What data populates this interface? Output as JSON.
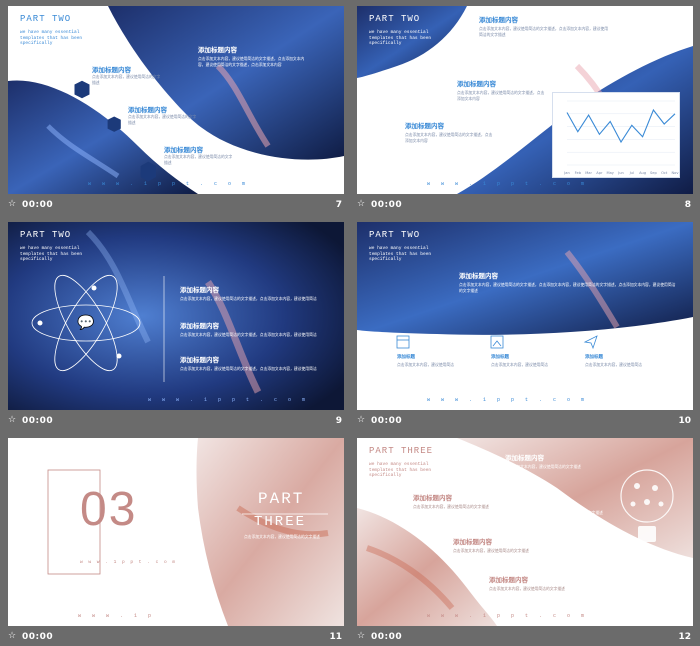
{
  "slides": {
    "s7": {
      "number": "7",
      "time": "00:00",
      "part": "PART TWO",
      "tagline": "we have many essential templates that has been specifically",
      "url": "w w w . 1 p p t . c o m",
      "heading_main": "添加标题内容",
      "heading_a": "添加标题内容",
      "heading_b": "添加标题内容",
      "heading_c": "添加标题内容",
      "body_main": "点击添加文本内容，建议使用简洁的文字描述，点击添加文本内容，建议使用简洁的文字描述，点击添加文本内容",
      "body_a": "点击添加文本内容，建议使用简洁的文字描述",
      "body_b": "点击添加文本内容，建议使用简洁的文字描述",
      "body_c": "点击添加文本内容，建议使用简洁的文字描述"
    },
    "s8": {
      "number": "8",
      "time": "00:00",
      "part": "PART TWO",
      "tagline": "we have many essential templates that has been specifically",
      "url": "w w w . 1 p p t . c o m",
      "heading_1": "添加标题内容",
      "heading_2": "添加标题内容",
      "heading_3": "添加标题内容",
      "body_1": "点击添加文本内容，建议使用简洁的文字描述，点击添加文本内容，建议使用简洁的文字描述",
      "body_2": "点击添加文本内容，建议使用简洁的文字描述，点击添加文本内容",
      "body_3": "点击添加文本内容，建议使用简洁的文字描述，点击添加文本内容"
    },
    "s9": {
      "number": "9",
      "time": "00:00",
      "part": "PART TWO",
      "tagline": "we have many essential templates that has been specifically",
      "url": "w w w . 1 p p t . c o m",
      "heading_1": "添加标题内容",
      "heading_2": "添加标题内容",
      "heading_3": "添加标题内容",
      "body_1": "点击添加文本内容，建议使用简洁的文字描述，点击添加文本内容，建议使用简洁",
      "body_2": "点击添加文本内容，建议使用简洁的文字描述，点击添加文本内容，建议使用简洁",
      "body_3": "点击添加文本内容，建议使用简洁的文字描述，点击添加文本内容，建议使用简洁"
    },
    "s10": {
      "number": "10",
      "time": "00:00",
      "part": "PART TWO",
      "tagline": "we have many essential templates that has been specifically",
      "url": "w w w . 1 p p t . c o m",
      "heading": "添加标题内容",
      "body": "点击添加文本内容，建议使用简洁的文字描述，点击添加文本内容，建议使用简洁的文字描述，点击添加文本内容，建议使用简洁的文字描述",
      "feat_1_title": "添加标题",
      "feat_2_title": "添加标题",
      "feat_3_title": "添加标题",
      "feat_1_body": "点击添加文本内容，建议使用简洁",
      "feat_2_body": "点击添加文本内容，建议使用简洁",
      "feat_3_body": "点击添加文本内容，建议使用简洁"
    },
    "s11": {
      "number": "11",
      "time": "00:00",
      "big_number": "03",
      "part_line1": "PART",
      "part_line2": "THREE",
      "url_small": "w w w . 1 p p t . c o m",
      "url": "w w w . 1 p",
      "body": "点击添加文本内容，建议使用简洁的文字描述"
    },
    "s12": {
      "number": "12",
      "time": "00:00",
      "part": "PART THREE",
      "tagline": "we have many essential templates that has been specifically",
      "url": "w w w . 1 p p t . c o m",
      "heading_1": "添加标题内容",
      "heading_2": "添加标题内容",
      "heading_3": "添加标题内容",
      "heading_4": "添加标题内容",
      "heading_5": "添加标题内容",
      "body_1": "点击添加文本内容，建议使用简洁的文字描述",
      "body_2": "点击添加文本内容，建议使用简洁的文字描述",
      "body_3": "点击添加文本内容，建议使用简洁的文字描述",
      "body_4": "点击添加文本内容，建议使用简洁的文字描述",
      "body_5": "点击添加文本内容，建议使用简洁的文字描述"
    }
  },
  "chart_data": {
    "type": "line",
    "categories": [
      "Jan",
      "Feb",
      "Mar",
      "Apr",
      "May",
      "Jun",
      "Jul",
      "Aug",
      "Sep",
      "Oct",
      "Nov"
    ],
    "values": [
      4.1,
      2.6,
      3.9,
      2.4,
      3.4,
      1.8,
      3.1,
      2.2,
      4.3,
      3.2,
      4.0
    ],
    "ylim": [
      0,
      5
    ]
  },
  "colors": {
    "accent_blue": "#3a8ad6",
    "dark_blue": "#1b2b57",
    "accent_pink": "#c48a86",
    "overlay_gray": "#6b6b6b"
  },
  "icons": {
    "footer": "star-icon",
    "s10_1": "calendar-icon",
    "s10_2": "image-icon",
    "s10_3": "send-icon",
    "s9": "chat-icon"
  }
}
